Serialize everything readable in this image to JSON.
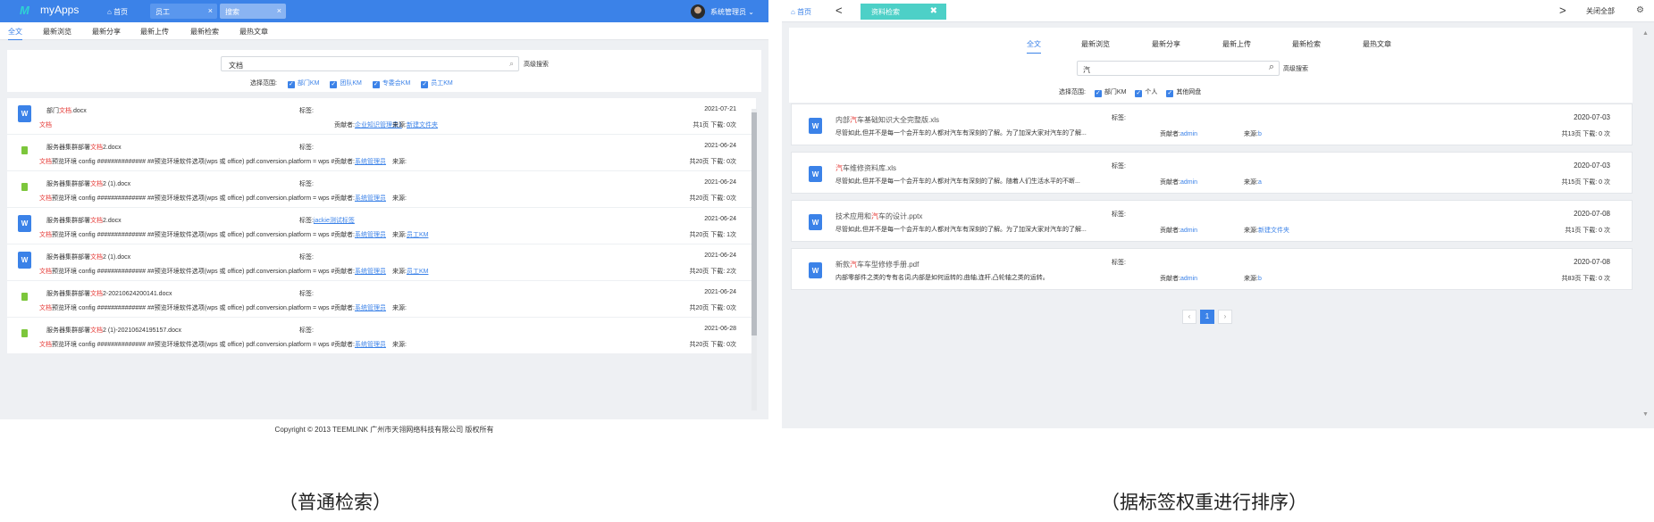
{
  "left": {
    "header": {
      "logo_mark": "M",
      "app_name": "myApps",
      "home_label": "首页",
      "tabs": [
        {
          "label": "员工",
          "close": "×"
        },
        {
          "label": "搜索",
          "close": "×"
        }
      ],
      "user_name": "系统管理员"
    },
    "subnav": [
      "全文",
      "最新浏览",
      "最新分享",
      "最新上传",
      "最新检索",
      "最热文章"
    ],
    "search": {
      "value": "文档",
      "advanced_label": "高级搜索",
      "scope_label": "选择范围:",
      "scopes": [
        "部门KM",
        "团队KM",
        "专委会KM",
        "员工KM"
      ]
    },
    "results": [
      {
        "icon": "W",
        "type": "word",
        "name_pre": "部门",
        "name_hl": "文档",
        "name_post": ".docx",
        "tag": "标签:",
        "tag_link": "",
        "snippet_hl": "文档",
        "snippet": "",
        "contributor_label": "贡献者:",
        "contributor": "企业知识管理员1",
        "source_label": "来源:",
        "source": "新建文件夹",
        "date": "2021-07-21",
        "stats": "共1页  下载: 0次"
      },
      {
        "icon": "",
        "type": "green",
        "name_pre": "服务器集群部署",
        "name_hl": "文档",
        "name_post": "2.docx",
        "tag": "标签:",
        "tag_link": "",
        "snippet_hl": "文档",
        "snippet": "预览环境 config ############## ##预览环境软件选项(wps 或 office) pdf.conversion.platform = wps ##########...",
        "contributor_label": "贡献者:",
        "contributor": "系统管理员",
        "source_label": "来源:",
        "source": "",
        "date": "2021-06-24",
        "stats": "共20页  下载: 0次"
      },
      {
        "icon": "",
        "type": "green",
        "name_pre": "服务器集群部署",
        "name_hl": "文档",
        "name_post": "2 (1).docx",
        "tag": "标签:",
        "tag_link": "",
        "snippet_hl": "文档",
        "snippet": "预览环境 config ############## ##预览环境软件选项(wps 或 office) pdf.conversion.platform = wps ##########...",
        "contributor_label": "贡献者:",
        "contributor": "系统管理员",
        "source_label": "来源:",
        "source": "",
        "date": "2021-06-24",
        "stats": "共20页  下载: 0次"
      },
      {
        "icon": "W",
        "type": "word",
        "name_pre": "服务器集群部署",
        "name_hl": "文档",
        "name_post": "2.docx",
        "tag": "标签:",
        "tag_link": "jackie测试标签",
        "snippet_hl": "文档",
        "snippet": "预览环境 config ############## ##预览环境软件选项(wps 或 office) pdf.conversion.platform = wps ##########...",
        "contributor_label": "贡献者:",
        "contributor": "系统管理员",
        "source_label": "来源:",
        "source": "员工KM",
        "date": "2021-06-24",
        "stats": "共20页  下载: 1次"
      },
      {
        "icon": "W",
        "type": "word",
        "name_pre": "服务器集群部署",
        "name_hl": "文档",
        "name_post": "2 (1).docx",
        "tag": "标签:",
        "tag_link": "",
        "snippet_hl": "文档",
        "snippet": "预览环境 config ############## ##预览环境软件选项(wps 或 office) pdf.conversion.platform = wps ##########...",
        "contributor_label": "贡献者:",
        "contributor": "系统管理员",
        "source_label": "来源:",
        "source": "员工KM",
        "date": "2021-06-24",
        "stats": "共20页  下载: 2次"
      },
      {
        "icon": "",
        "type": "green",
        "name_pre": "服务器集群部署",
        "name_hl": "文档",
        "name_post": "2-20210624200141.docx",
        "tag": "标签:",
        "tag_link": "",
        "snippet_hl": "文档",
        "snippet": "预览环境 config ############## ##预览环境软件选项(wps 或 office) pdf.conversion.platform = wps ##########...",
        "contributor_label": "贡献者:",
        "contributor": "系统管理员",
        "source_label": "来源:",
        "source": "",
        "date": "2021-06-24",
        "stats": "共20页  下载: 0次"
      },
      {
        "icon": "",
        "type": "green",
        "name_pre": "服务器集群部署",
        "name_hl": "文档",
        "name_post": "2 (1)-20210624195157.docx",
        "tag": "标签:",
        "tag_link": "",
        "snippet_hl": "文档",
        "snippet": "预览环境 config ############## ##预览环境软件选项(wps 或 office) pdf.conversion.platform = wps ##########...",
        "contributor_label": "贡献者:",
        "contributor": "系统管理员",
        "source_label": "来源:",
        "source": "",
        "date": "2021-06-28",
        "stats": "共20页  下载: 0次"
      }
    ],
    "footer": "Copyright © 2013 TEEMLINK 广州市天翎网络科技有限公司 版权所有"
  },
  "right": {
    "header": {
      "home_label": "首页",
      "back_icon": "<",
      "tab_label": "资料检索",
      "tab_close": "✖",
      "forward_icon": ">",
      "close_all_label": "关闭全部",
      "gear_icon": "⚙"
    },
    "subnav": [
      "全文",
      "最新浏览",
      "最新分享",
      "最新上传",
      "最新检索",
      "最热文章"
    ],
    "search": {
      "value": "汽",
      "advanced_label": "高级搜索",
      "scope_label": "选择范围:",
      "scopes": [
        "部门KM",
        "个人",
        "其他网盘"
      ]
    },
    "results": [
      {
        "icon": "W",
        "name_pre": "内部",
        "name_hl": "汽",
        "name_post": "车基础知识大全完整版.xls",
        "snippet": "尽管如此,但并不是每一个会开车的人都对汽车有深刻的了解。为了加深大家对汽车的了解...",
        "tag": "标签:",
        "contributor_label": "贡献者:",
        "contributor": "admin",
        "source_label": "来源:",
        "source": "b",
        "date": "2020-07-03",
        "stats": "共13页    下载: 0 次"
      },
      {
        "icon": "W",
        "name_pre": "",
        "name_hl": "汽",
        "name_post": "车维修资料库.xls",
        "snippet": "尽管如此,但并不是每一个会开车的人都对汽车有深刻的了解。随着人们生活水平的不断...",
        "tag": "标签:",
        "contributor_label": "贡献者:",
        "contributor": "admin",
        "source_label": "来源:",
        "source": "a",
        "date": "2020-07-03",
        "stats": "共15页    下载: 0 次"
      },
      {
        "icon": "W",
        "name_pre": "技术应用和",
        "name_hl": "汽",
        "name_post": "车的设计.pptx",
        "snippet": "尽管如此,但并不是每一个会开车的人都对汽车有深刻的了解。为了加深大家对汽车的了解...",
        "tag": "标签:",
        "contributor_label": "贡献者:",
        "contributor": "admin",
        "source_label": "来源:",
        "source": "新建文件夹",
        "date": "2020-07-08",
        "stats": "共1页    下载: 0 次"
      },
      {
        "icon": "W",
        "name_pre": "新款",
        "name_hl": "汽",
        "name_post": "车车型修修手册.pdf",
        "snippet": "内部零部件之类的专有名词,内部是如何运转的,曲轴,连杆,凸轮轴之类的运转。",
        "tag": "标签:",
        "contributor_label": "贡献者:",
        "contributor": "admin",
        "source_label": "来源:",
        "source": "b",
        "date": "2020-07-08",
        "stats": "共83页    下载: 0 次"
      }
    ],
    "pager": {
      "prev": "‹",
      "current": "1",
      "next": "›"
    }
  },
  "captions": {
    "left": "（普通检索）",
    "right": "（据标签权重进行排序）"
  },
  "colors": {
    "primary": "#3b82e8",
    "highlight": "#e53935",
    "tab_teal": "#4dd0c7"
  }
}
